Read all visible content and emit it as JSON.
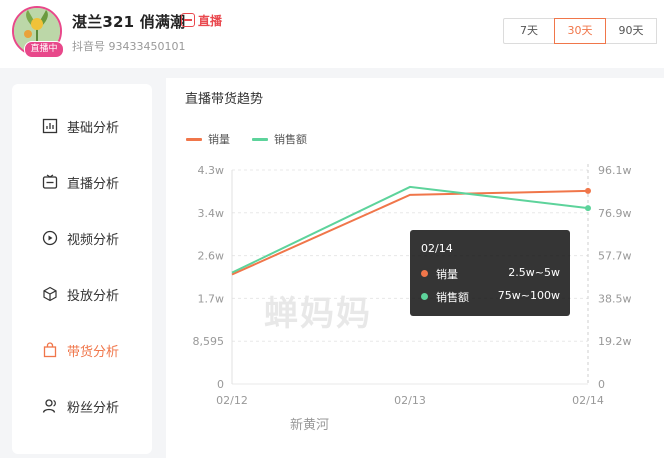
{
  "header": {
    "username": "湛兰321 俏满潮",
    "live_mark_label": "直播",
    "douyin_id": "抖音号 93433450101",
    "live_badge": "直播中"
  },
  "date_range": {
    "options": [
      "7天",
      "30天",
      "90天"
    ],
    "selected": "30天"
  },
  "sidebar": {
    "items": [
      {
        "label": "基础分析",
        "icon": "bar-chart-icon",
        "active": false
      },
      {
        "label": "直播分析",
        "icon": "live-icon",
        "active": false
      },
      {
        "label": "视频分析",
        "icon": "play-circle-icon",
        "active": false
      },
      {
        "label": "投放分析",
        "icon": "cube-icon",
        "active": false
      },
      {
        "label": "带货分析",
        "icon": "shopping-bag-icon",
        "active": true
      },
      {
        "label": "粉丝分析",
        "icon": "user-icon",
        "active": false
      }
    ]
  },
  "section": {
    "title": "直播带货趋势"
  },
  "colors": {
    "accent": "#f0764a",
    "sales": "#f0764a",
    "revenue": "#5dd39b"
  },
  "chart_data": {
    "type": "line",
    "categories": [
      "02/12",
      "02/13",
      "02/14"
    ],
    "series": [
      {
        "name": "销量",
        "axis": "left",
        "values": [
          22000,
          38000,
          38800
        ]
      },
      {
        "name": "销售额",
        "axis": "right",
        "values": [
          50000,
          88500,
          79000
        ]
      }
    ],
    "y_left": {
      "range": [
        0,
        43000
      ],
      "ticks": [
        "0",
        "8,595",
        "1.7w",
        "2.6w",
        "3.4w",
        "4.3w"
      ]
    },
    "y_right": {
      "range": [
        0,
        96100
      ],
      "ticks": [
        "0",
        "19.2w",
        "38.5w",
        "57.7w",
        "76.9w",
        "96.1w"
      ]
    },
    "legend_placement": "top-left",
    "grid": "horizontal-dashed",
    "tooltip": {
      "date": "02/14",
      "rows": [
        {
          "name": "销量",
          "value": "2.5w~5w"
        },
        {
          "name": "销售额",
          "value": "75w~100w"
        }
      ]
    }
  },
  "watermarks": {
    "brand": "蝉妈妈",
    "source": "新黄河"
  }
}
